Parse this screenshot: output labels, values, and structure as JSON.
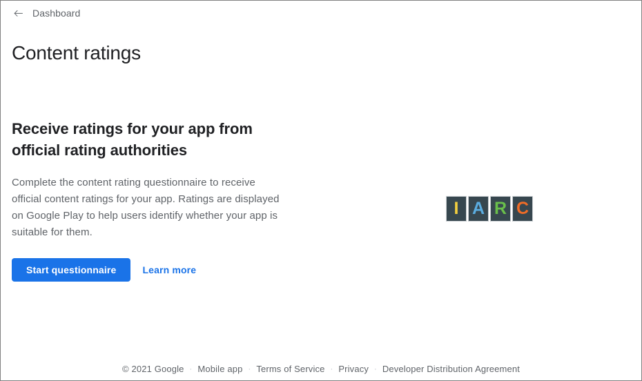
{
  "window": {
    "border_color": "#808080",
    "background": "#ffffff"
  },
  "header": {
    "back_icon": "arrow-left-icon",
    "back_label": "Dashboard",
    "page_title": "Content ratings"
  },
  "main": {
    "heading": "Receive ratings for your app from official rating authorities",
    "body": "Complete the content rating questionnaire to receive official content ratings for your app. Ratings are displayed on Google Play to help users identify whether your app is suitable for them.",
    "primary_button": "Start questionnaire",
    "secondary_link": "Learn more",
    "colors": {
      "accent": "#1a73e8",
      "heading": "#202124",
      "body": "#5f6368"
    }
  },
  "logo": {
    "name": "iarc-logo",
    "tiles": [
      {
        "letter": "I",
        "color": "#f4d03f",
        "background": "#37474f"
      },
      {
        "letter": "A",
        "color": "#5bade0",
        "background": "#37474f"
      },
      {
        "letter": "R",
        "color": "#6abf4b",
        "background": "#37474f"
      },
      {
        "letter": "C",
        "color": "#ef6c27",
        "background": "#37474f"
      }
    ]
  },
  "footer": {
    "separator": "·",
    "items": [
      {
        "label": "© 2021 Google",
        "link": false
      },
      {
        "label": "Mobile app",
        "link": true
      },
      {
        "label": "Terms of Service",
        "link": true
      },
      {
        "label": "Privacy",
        "link": true
      },
      {
        "label": "Developer Distribution Agreement",
        "link": true
      }
    ]
  }
}
